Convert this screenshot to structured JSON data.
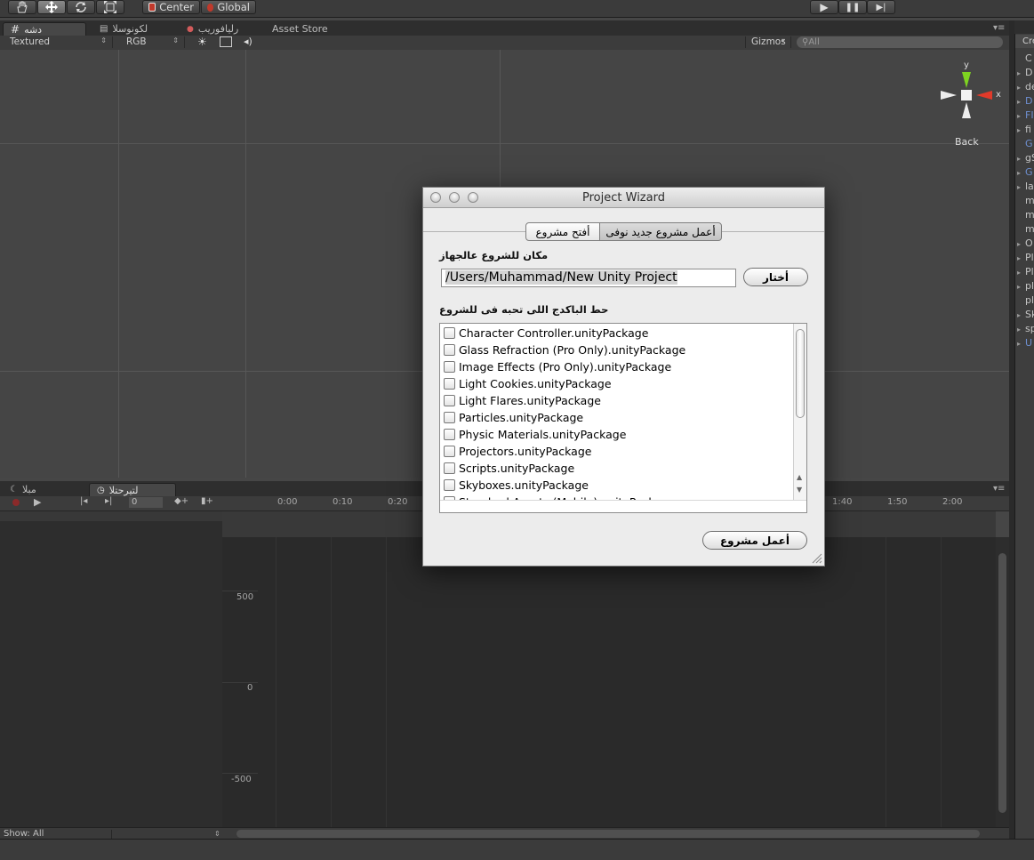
{
  "toolbar": {
    "tools": [
      "hand-tool",
      "move-tool",
      "rotate-tool",
      "scale-tool"
    ],
    "pivot_center": "Center",
    "pivot_global": "Global",
    "play": "▶",
    "pause": "❚❚",
    "step": "▶|"
  },
  "scene_tabs": [
    {
      "label": "دشه",
      "icon": "grid-icon"
    },
    {
      "label": "لكونوسلا",
      "icon": "document-icon"
    },
    {
      "label": "رليافوريب",
      "icon": "profiler-icon"
    },
    {
      "label": "Asset Store"
    }
  ],
  "scene_bar": {
    "textured": "Textured",
    "rgb": "RGB",
    "gizmos": "Gizmos",
    "search_placeholder": "All"
  },
  "gizmo": {
    "y_label": "y",
    "x_label": "x",
    "view_label": "Back"
  },
  "bottom_tabs": [
    {
      "label": "مبلا",
      "icon": "moon-icon"
    },
    {
      "label": "لتيرحتلا",
      "icon": "clock-icon"
    }
  ],
  "animation": {
    "frame": "0",
    "time_ticks": [
      "0:00",
      "0:10",
      "0:20",
      "1:40",
      "1:50",
      "2:00"
    ],
    "value_ticks": [
      "500",
      "0",
      "-500"
    ],
    "show_label": "Show: All"
  },
  "hierarchy": {
    "header": "Cre",
    "rows": [
      {
        "text": "C",
        "arrow": false,
        "blue": false
      },
      {
        "text": "D",
        "arrow": true,
        "blue": false
      },
      {
        "text": "de",
        "arrow": true,
        "blue": false
      },
      {
        "text": "D",
        "arrow": true,
        "blue": true
      },
      {
        "text": "FI",
        "arrow": true,
        "blue": true
      },
      {
        "text": "fi",
        "arrow": true,
        "blue": false
      },
      {
        "text": "G",
        "arrow": false,
        "blue": true
      },
      {
        "text": "gS",
        "arrow": true,
        "blue": false
      },
      {
        "text": "G",
        "arrow": true,
        "blue": true
      },
      {
        "text": "la",
        "arrow": true,
        "blue": false
      },
      {
        "text": "m",
        "arrow": false,
        "blue": false
      },
      {
        "text": "m",
        "arrow": false,
        "blue": false
      },
      {
        "text": "m",
        "arrow": false,
        "blue": false
      },
      {
        "text": "O",
        "arrow": true,
        "blue": false
      },
      {
        "text": "Pl",
        "arrow": true,
        "blue": false
      },
      {
        "text": "Pl",
        "arrow": true,
        "blue": false
      },
      {
        "text": "pl",
        "arrow": true,
        "blue": false
      },
      {
        "text": "pl",
        "arrow": false,
        "blue": false
      },
      {
        "text": "Sk",
        "arrow": true,
        "blue": false
      },
      {
        "text": "sp",
        "arrow": true,
        "blue": false
      },
      {
        "text": "U",
        "arrow": true,
        "blue": true
      }
    ]
  },
  "dialog": {
    "title": "Project Wizard",
    "tab_open": "أفتح مشروع",
    "tab_new": "أعمل مشروع جديد نوفى",
    "location_label": "مكان للشروع عالجهاز",
    "path_value": "/Users/Muhammad/New Unity Project",
    "browse_button": "أختار",
    "packages_label": "حط الباكدج اللى تحبه فى للشروع",
    "packages": [
      "Character Controller.unityPackage",
      "Glass Refraction (Pro Only).unityPackage",
      "Image Effects (Pro Only).unityPackage",
      "Light Cookies.unityPackage",
      "Light Flares.unityPackage",
      "Particles.unityPackage",
      "Physic Materials.unityPackage",
      "Projectors.unityPackage",
      "Scripts.unityPackage",
      "Skyboxes.unityPackage",
      "Standard Assets (Mobile).unityPackage"
    ],
    "create_button": "أعمل مشروع"
  }
}
